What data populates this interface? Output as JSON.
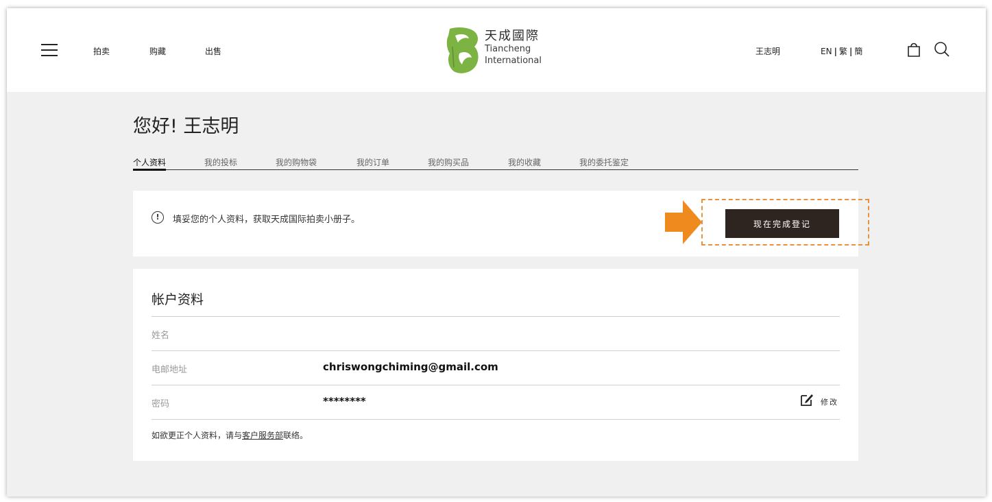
{
  "header": {
    "nav": [
      "拍卖",
      "购藏",
      "出售"
    ],
    "logo": {
      "cn": "天成國際",
      "en_line1": "Tiancheng",
      "en_line2": "International"
    },
    "user_name": "王志明",
    "lang": {
      "en": "EN",
      "trad": "繁",
      "simp": "簡"
    }
  },
  "greeting": "您好! 王志明",
  "tabs": [
    "个人资料",
    "我的投标",
    "我的购物袋",
    "我的订单",
    "我的购买品",
    "我的收藏",
    "我的委托鉴定"
  ],
  "notice": {
    "icon": "!",
    "text": "填妥您的个人资料，获取天成国际拍卖小册子。",
    "button": "现在完成登记"
  },
  "account": {
    "title": "帐户资料",
    "rows": [
      {
        "label": "姓名",
        "value": ""
      },
      {
        "label": "电邮地址",
        "value": "chriswongchiming@gmail.com"
      },
      {
        "label": "密码",
        "value": "********"
      }
    ],
    "edit_label": "修改",
    "footer_prefix": "如欲更正个人资料，请与",
    "footer_link": "客户服务部",
    "footer_suffix": "联络。"
  },
  "colors": {
    "logo_green": "#7cb342",
    "button_dark": "#2e2520",
    "highlight_orange": "#e8903a",
    "arrow_orange": "#ef8a1e"
  }
}
